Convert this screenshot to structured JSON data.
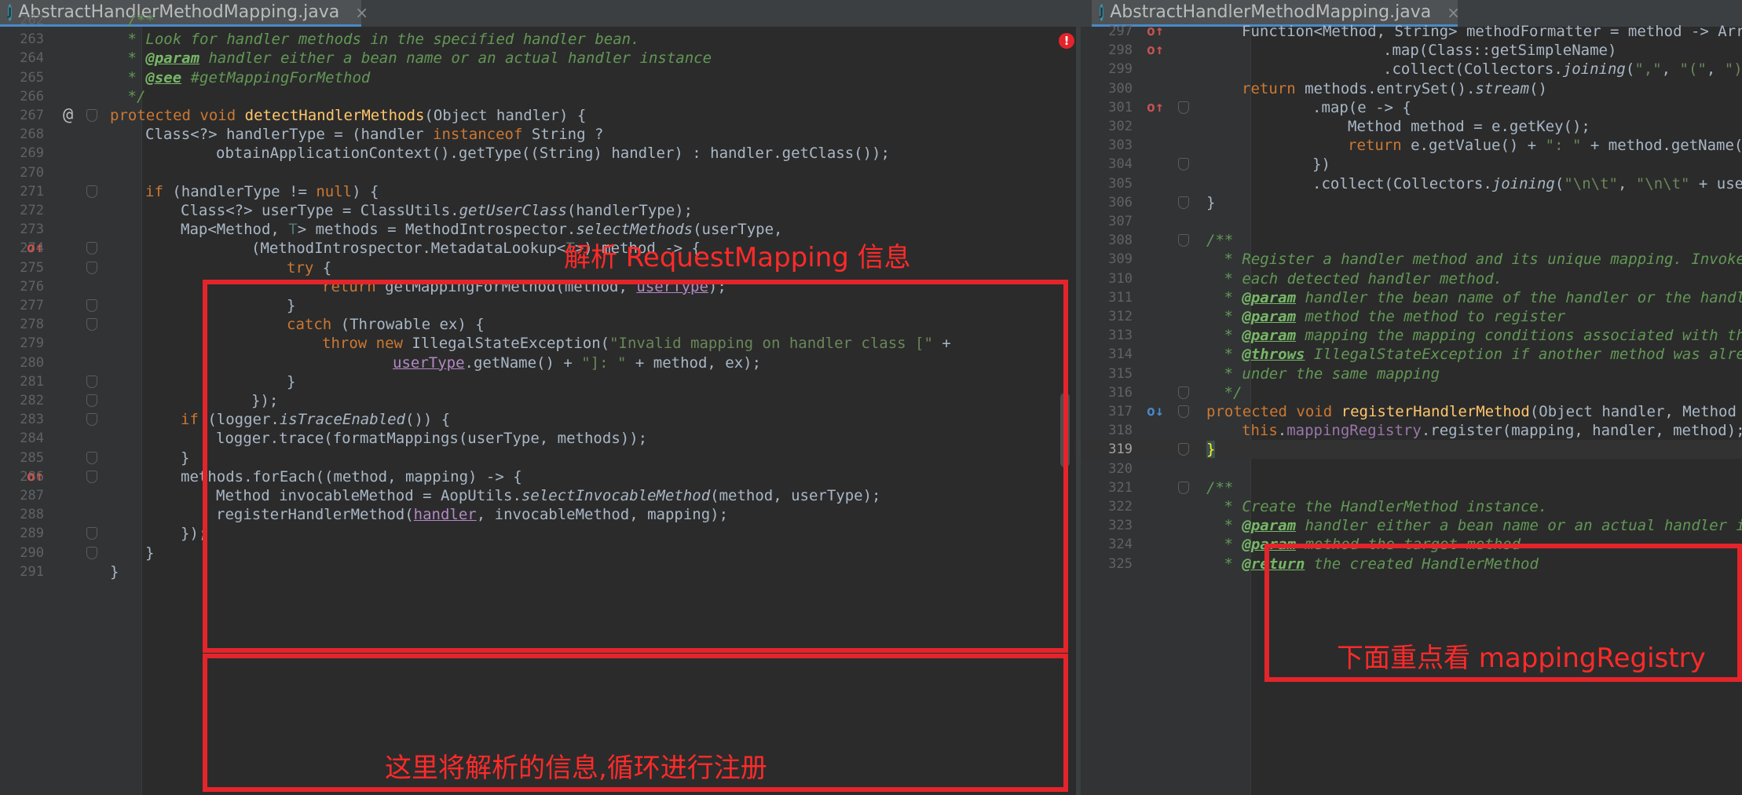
{
  "left_tab": {
    "title": "AbstractHandlerMethodMapping.java",
    "close": "×",
    "icon": "J"
  },
  "right_tab": {
    "title": "AbstractHandlerMethodMapping.java",
    "close": "×",
    "icon": "J"
  },
  "left_editor": {
    "lines": [
      {
        "n": "262",
        "code": "/**"
      },
      {
        "n": "263",
        "code": "* Look for handler methods in the specified handler bean."
      },
      {
        "n": "264",
        "code": "* @param handler either a bean name or an actual handler instance"
      },
      {
        "n": "265",
        "code": "* @see #getMappingForMethod"
      },
      {
        "n": "266",
        "code": "*/"
      },
      {
        "n": "267",
        "code": "protected void detectHandlerMethods(Object handler) {",
        "marker": "@"
      },
      {
        "n": "268",
        "code": "Class<?> handlerType = (handler instanceof String ?"
      },
      {
        "n": "269",
        "code": "obtainApplicationContext().getType((String) handler) : handler.getClass());"
      },
      {
        "n": "270",
        "code": ""
      },
      {
        "n": "271",
        "code": "if (handlerType != null) {"
      },
      {
        "n": "272",
        "code": "Class<?> userType = ClassUtils.getUserClass(handlerType);"
      },
      {
        "n": "273",
        "code": "Map<Method, T> methods = MethodIntrospector.selectMethods(userType,"
      },
      {
        "n": "274",
        "code": "(MethodIntrospector.MetadataLookup<T>) method -> {",
        "marker": "o↑"
      },
      {
        "n": "275",
        "code": "try {"
      },
      {
        "n": "276",
        "code": "return getMappingForMethod(method, userType);"
      },
      {
        "n": "277",
        "code": "}"
      },
      {
        "n": "278",
        "code": "catch (Throwable ex) {"
      },
      {
        "n": "279",
        "code": "throw new IllegalStateException(\"Invalid mapping on handler class [\" +"
      },
      {
        "n": "280",
        "code": "userType.getName() + \"]: \" + method, ex);"
      },
      {
        "n": "281",
        "code": "}"
      },
      {
        "n": "282",
        "code": "});"
      },
      {
        "n": "283",
        "code": "if (logger.isTraceEnabled()) {"
      },
      {
        "n": "284",
        "code": "logger.trace(formatMappings(userType, methods));"
      },
      {
        "n": "285",
        "code": "}"
      },
      {
        "n": "286",
        "code": "methods.forEach((method, mapping) -> {",
        "marker": "o↑"
      },
      {
        "n": "287",
        "code": "Method invocableMethod = AopUtils.selectInvocableMethod(method, userType);"
      },
      {
        "n": "288",
        "code": "registerHandlerMethod(handler, invocableMethod, mapping);"
      },
      {
        "n": "289",
        "code": "});"
      },
      {
        "n": "290",
        "code": "}"
      },
      {
        "n": "291",
        "code": "}"
      }
    ],
    "error_icon": "!",
    "annotation_top": "解析 RequestMapping 信息",
    "annotation_bottom": "这里将解析的信息,循环进行注册"
  },
  "right_editor": {
    "lines": [
      {
        "n": "297",
        "code": "Function<Method, String> methodFormatter = method -> Arrays.stream(method.getParameterTypes())",
        "marker": "o↑"
      },
      {
        "n": "298",
        "code": ".map(Class::getSimpleName)",
        "marker": "o↑"
      },
      {
        "n": "299",
        "code": ".collect(Collectors.joining(\",\", \"(\", \")\"));"
      },
      {
        "n": "300",
        "code": "return methods.entrySet().stream()"
      },
      {
        "n": "301",
        "code": ".map(e -> {",
        "marker": "o↑"
      },
      {
        "n": "302",
        "code": "Method method = e.getKey();"
      },
      {
        "n": "303",
        "code": "return e.getValue() + \": \" + method.getName() + methodFormatter.apply(method);"
      },
      {
        "n": "304",
        "code": "})"
      },
      {
        "n": "305",
        "code": ".collect(Collectors.joining(\"\\n\\t\", \"\\n\\t\" + userType.getName() + \":\" + \"\\n\\t\", \"\"));"
      },
      {
        "n": "306",
        "code": "}"
      },
      {
        "n": "307",
        "code": ""
      },
      {
        "n": "308",
        "code": "/**"
      },
      {
        "n": "309",
        "code": "* Register a handler method and its unique mapping. Invoked at startup for"
      },
      {
        "n": "310",
        "code": "* each detected handler method."
      },
      {
        "n": "311",
        "code": "* @param handler the bean name of the handler or the handler instance"
      },
      {
        "n": "312",
        "code": "* @param method the method to register"
      },
      {
        "n": "313",
        "code": "* @param mapping the mapping conditions associated with the handler method"
      },
      {
        "n": "314",
        "code": "* @throws IllegalStateException if another method was already registered"
      },
      {
        "n": "315",
        "code": "* under the same mapping"
      },
      {
        "n": "316",
        "code": "*/"
      },
      {
        "n": "317",
        "code": "protected void registerHandlerMethod(Object handler, Method method, T mapping) {",
        "marker": "o↓"
      },
      {
        "n": "318",
        "code": "this.mappingRegistry.register(mapping, handler, method);"
      },
      {
        "n": "319",
        "code": "}"
      },
      {
        "n": "320",
        "code": ""
      },
      {
        "n": "321",
        "code": "/**"
      },
      {
        "n": "322",
        "code": "* Create the HandlerMethod instance."
      },
      {
        "n": "323",
        "code": "* @param handler either a bean name or an actual handler instance"
      },
      {
        "n": "324",
        "code": "* @param method the target method"
      },
      {
        "n": "325",
        "code": "* @return the created HandlerMethod"
      }
    ],
    "annotation": "下面重点看 mappingRegistry"
  }
}
